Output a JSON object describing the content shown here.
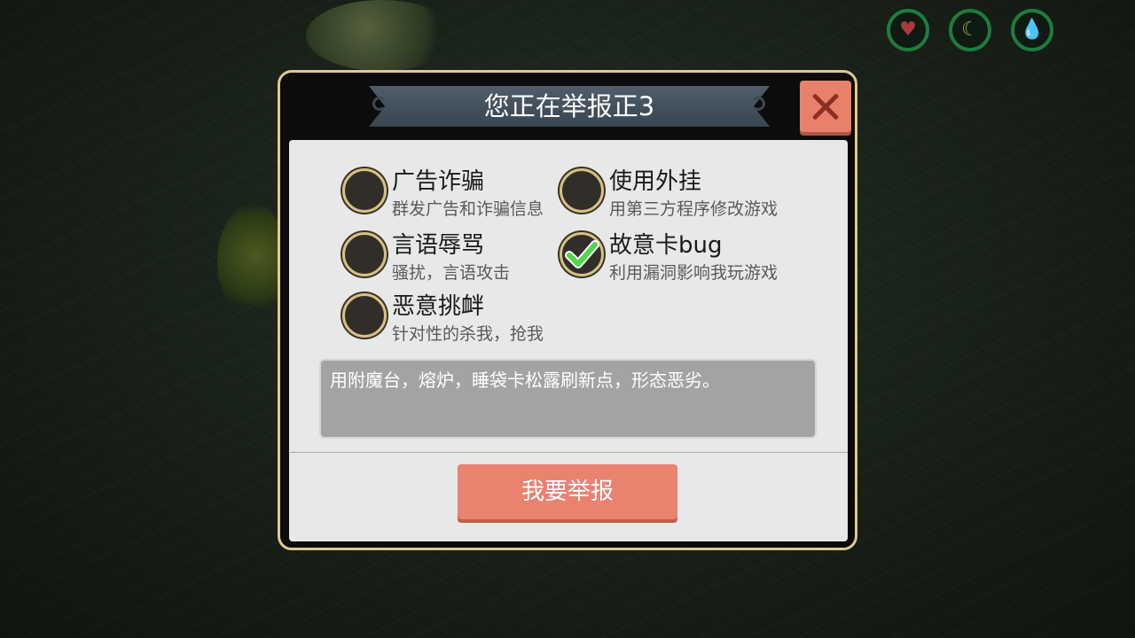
{
  "hud": {
    "health_icon": "heart-icon",
    "hunger_icon": "stomach-icon",
    "water_icon": "water-drop-icon",
    "health_color": "#a83a3f",
    "hunger_color": "#a8a238",
    "water_color": "#2a9db5"
  },
  "dialog": {
    "title": "您正在举报正3",
    "close_icon": "close-icon",
    "accent_color": "#ea8270"
  },
  "options": [
    {
      "title": "广告诈骗",
      "desc": "群发广告和诈骗信息",
      "checked": false
    },
    {
      "title": "使用外挂",
      "desc": "用第三方程序修改游戏",
      "checked": false
    },
    {
      "title": "言语辱骂",
      "desc": "骚扰，言语攻击",
      "checked": false
    },
    {
      "title": "故意卡bug",
      "desc": "利用漏洞影响我玩游戏",
      "checked": true
    },
    {
      "title": "恶意挑衅",
      "desc": "针对性的杀我，抢我",
      "checked": false
    }
  ],
  "description": {
    "value": "用附魔台，熔炉，睡袋卡松露刷新点，形态恶劣。"
  },
  "submit": {
    "label": "我要举报"
  }
}
